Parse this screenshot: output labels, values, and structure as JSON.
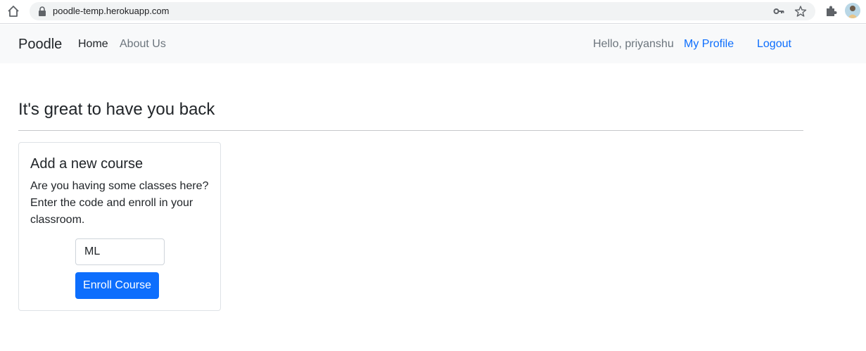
{
  "browser": {
    "url": "poodle-temp.herokuapp.com",
    "icons": [
      "home-icon",
      "lock-icon",
      "key-icon",
      "star-icon",
      "puzzle-icon",
      "avatar"
    ]
  },
  "navbar": {
    "brand": "Poodle",
    "links": [
      "Home",
      "About Us"
    ],
    "greeting": "Hello, priyanshu",
    "profile_label": "My Profile",
    "logout_label": "Logout"
  },
  "main": {
    "heading": "It's great to have you back"
  },
  "course_card": {
    "title": "Add a new course",
    "text": "Are you having some classes here? Enter the code and enroll in your classroom.",
    "input_value": "ML",
    "button_label": "Enroll Course"
  },
  "colors": {
    "primary": "#0d6efd",
    "navbar_bg": "#f8f9fa",
    "text": "#212529",
    "muted": "#6c757d"
  }
}
